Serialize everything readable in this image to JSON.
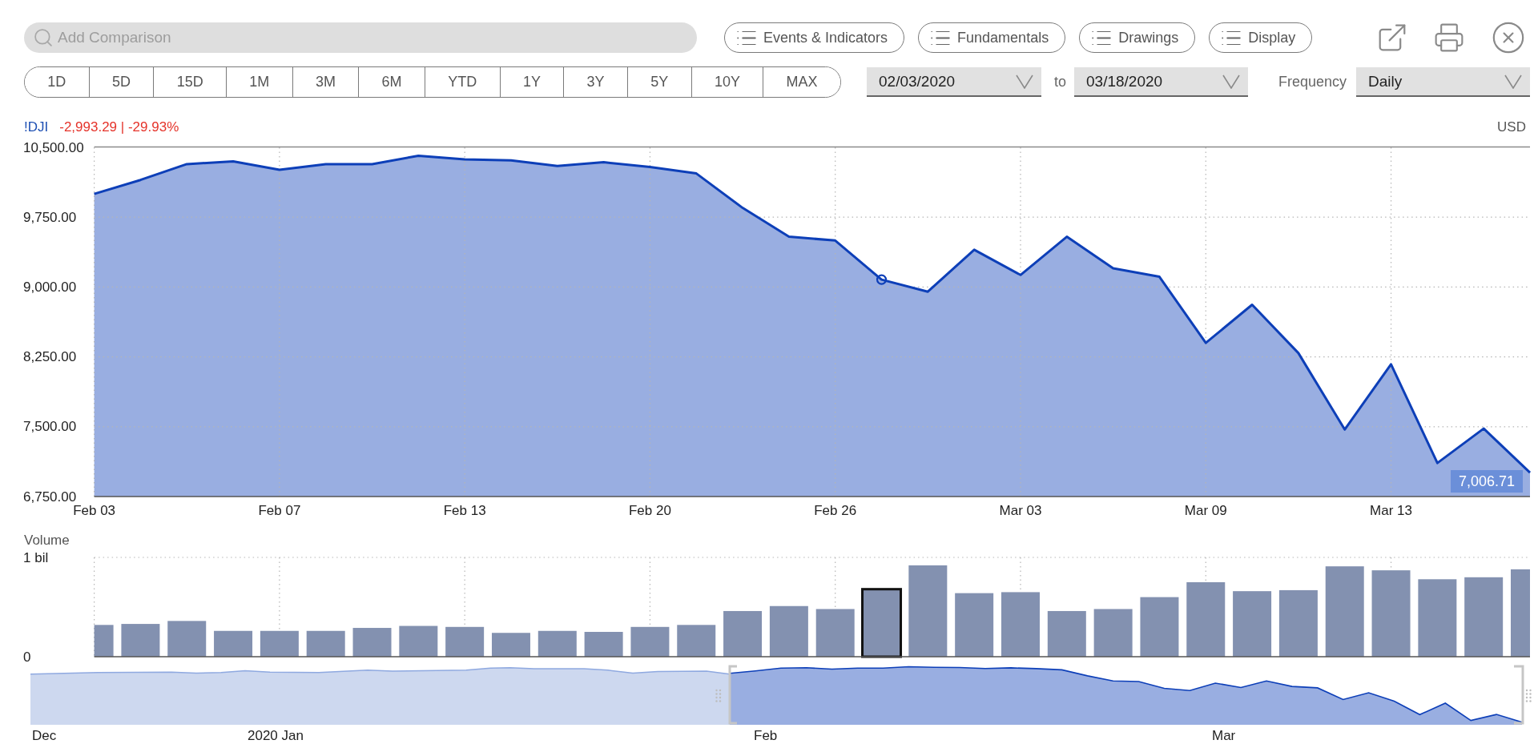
{
  "toolbar": {
    "search": {
      "placeholder": "Add Comparison"
    },
    "menu_buttons": [
      {
        "label": "Events & Indicators"
      },
      {
        "label": "Fundamentals"
      },
      {
        "label": "Drawings"
      },
      {
        "label": "Display"
      }
    ]
  },
  "ranges": [
    {
      "label": "1D",
      "selected": false
    },
    {
      "label": "5D",
      "selected": false
    },
    {
      "label": "15D",
      "selected": false
    },
    {
      "label": "1M",
      "selected": false
    },
    {
      "label": "3M",
      "selected": false
    },
    {
      "label": "6M",
      "selected": false
    },
    {
      "label": "YTD",
      "selected": false
    },
    {
      "label": "1Y",
      "selected": false
    },
    {
      "label": "3Y",
      "selected": false
    },
    {
      "label": "5Y",
      "selected": false
    },
    {
      "label": "10Y",
      "selected": false
    },
    {
      "label": "MAX",
      "selected": false
    }
  ],
  "date_range": {
    "from": "02/03/2020",
    "separator": "to",
    "to": "03/18/2020"
  },
  "frequency": {
    "label": "Frequency",
    "value": "Daily"
  },
  "quote": {
    "change": "-2,993.29 | -29.93%",
    "currency": "USD"
  },
  "price_chart": {
    "chart_data": {
      "type": "area",
      "categories": [
        "Feb 03",
        null,
        null,
        null,
        "Feb 07",
        null,
        null,
        null,
        "Feb 13",
        null,
        null,
        null,
        "Feb 20",
        null,
        null,
        null,
        "Feb 26",
        null,
        null,
        null,
        "Mar 03",
        null,
        null,
        null,
        "Mar 09",
        null,
        null,
        null,
        "Mar 13",
        null,
        null,
        null
      ],
      "series": [
        {
          "name": "!DJI",
          "color": "#0d3fb8",
          "values": [
            10000,
            10150,
            10320,
            10350,
            10260,
            10320,
            10320,
            10410,
            10370,
            10360,
            10300,
            10340,
            10290,
            10220,
            9850,
            9540,
            9500,
            9080,
            8950,
            9400,
            9130,
            9540,
            9200,
            9110,
            8400,
            8810,
            8290,
            7470,
            8170,
            7110,
            7480,
            7006.71
          ]
        }
      ],
      "ylim": [
        6750,
        10500
      ],
      "yticks": [
        {
          "value": 10500,
          "label": "10,500.00"
        },
        {
          "value": 9750,
          "label": "9,750.00"
        },
        {
          "value": 9000,
          "label": "9,000.00"
        },
        {
          "value": 8250,
          "label": "8,250.00"
        },
        {
          "value": 7500,
          "label": "7,500.00"
        },
        {
          "value": 6750,
          "label": "6,750.00"
        }
      ],
      "grid": true,
      "annotations": [
        "7,006.71"
      ]
    },
    "points": [
      {
        "hovered": false
      },
      {
        "hovered": false
      },
      {
        "hovered": false
      },
      {
        "hovered": false
      },
      {
        "hovered": false
      },
      {
        "hovered": false
      },
      {
        "hovered": false
      },
      {
        "hovered": false
      },
      {
        "hovered": false
      },
      {
        "hovered": false
      },
      {
        "hovered": false
      },
      {
        "hovered": false
      },
      {
        "hovered": false
      },
      {
        "hovered": false
      },
      {
        "hovered": false
      },
      {
        "hovered": false
      },
      {
        "hovered": false
      },
      {
        "hovered": true
      },
      {
        "hovered": false
      },
      {
        "hovered": false
      },
      {
        "hovered": false
      },
      {
        "hovered": false
      },
      {
        "hovered": false
      },
      {
        "hovered": false
      },
      {
        "hovered": false
      },
      {
        "hovered": false
      },
      {
        "hovered": false
      },
      {
        "hovered": false
      },
      {
        "hovered": false
      },
      {
        "hovered": false
      },
      {
        "hovered": false
      },
      {
        "hovered": false
      }
    ]
  },
  "volume_chart": {
    "chart_data": {
      "type": "bar",
      "title": "Volume",
      "values": [
        0.32,
        0.33,
        0.36,
        0.26,
        0.26,
        0.26,
        0.29,
        0.31,
        0.3,
        0.24,
        0.26,
        0.25,
        0.3,
        0.32,
        0.46,
        0.51,
        0.48,
        0.68,
        0.92,
        0.64,
        0.65,
        0.46,
        0.48,
        0.6,
        0.75,
        0.66,
        0.67,
        0.91,
        0.87,
        0.78,
        0.8,
        0.88
      ],
      "ylim": [
        0,
        1
      ],
      "yticks": [
        {
          "value": 1,
          "label": "1 bil"
        },
        {
          "value": 0,
          "label": "0"
        }
      ],
      "grid": true
    }
  },
  "navigator": {
    "labels": [
      "Dec",
      "2020 Jan",
      "Feb",
      "Mar"
    ]
  }
}
